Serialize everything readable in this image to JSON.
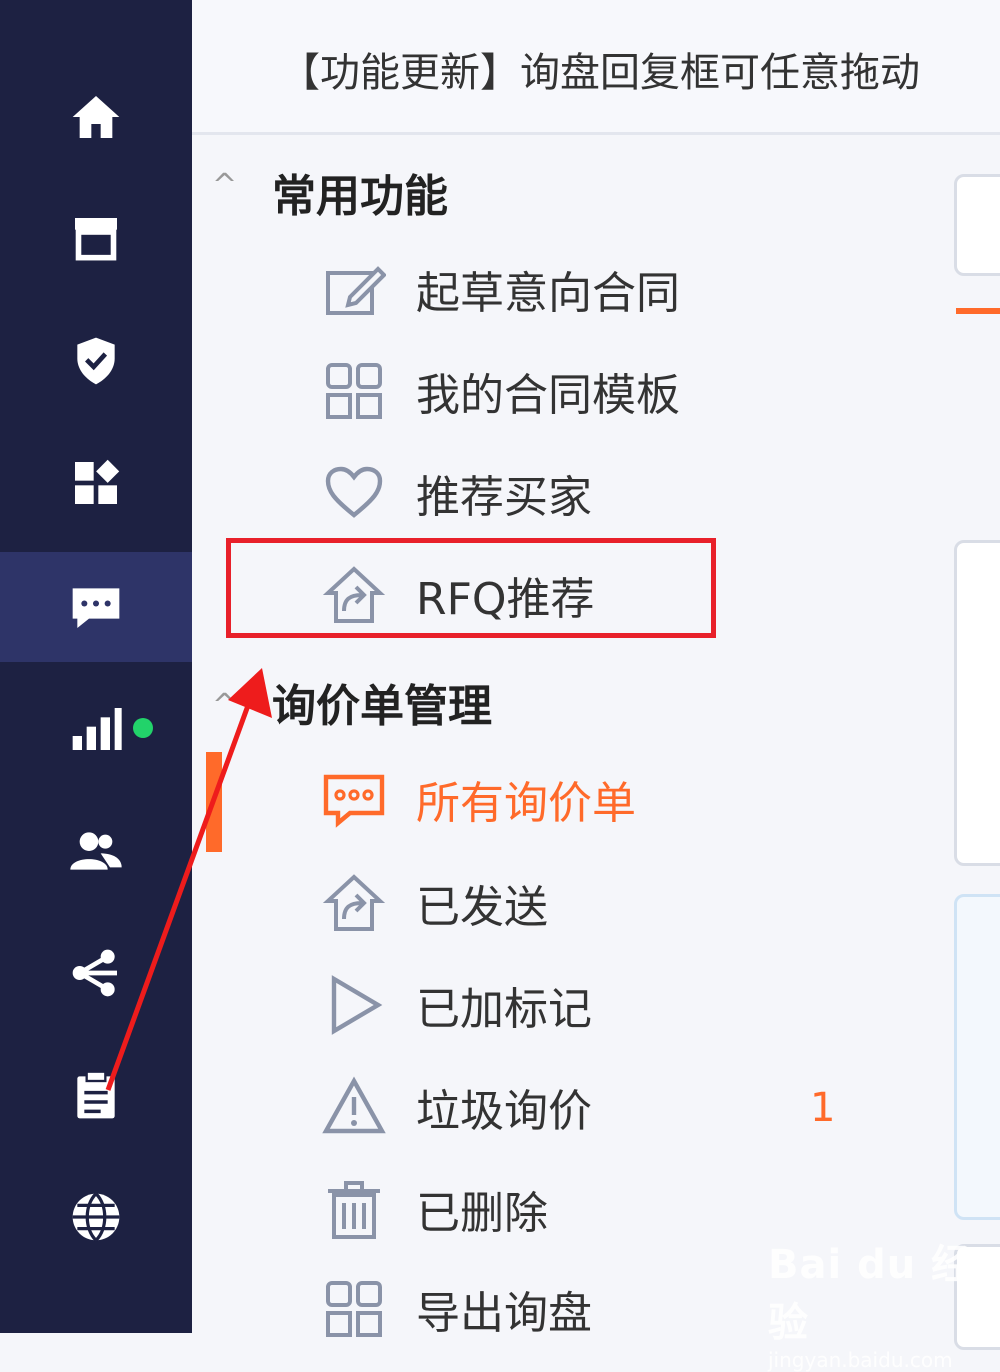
{
  "banner": {
    "text": "【功能更新】询盘回复框可任意拖动"
  },
  "sections": [
    {
      "title": "常用功能",
      "caret": "^"
    },
    {
      "title": "询价单管理",
      "caret": "^"
    }
  ],
  "common_items": [
    {
      "label": "起草意向合同",
      "icon": "edit-icon"
    },
    {
      "label": "我的合同模板",
      "icon": "grid-icon"
    },
    {
      "label": "推荐买家",
      "icon": "heart-icon"
    },
    {
      "label": "RFQ推荐",
      "icon": "house-arrow-icon"
    }
  ],
  "inquiry_items": [
    {
      "label": "所有询价单",
      "icon": "message-icon",
      "active": true
    },
    {
      "label": "已发送",
      "icon": "house-arrow-icon"
    },
    {
      "label": "已加标记",
      "icon": "flag-icon"
    },
    {
      "label": "垃圾询价",
      "icon": "warning-icon",
      "badge": "1"
    },
    {
      "label": "已删除",
      "icon": "trash-icon"
    },
    {
      "label": "导出询盘",
      "icon": "grid-icon"
    }
  ],
  "rail_icons": [
    "home-icon",
    "store-icon",
    "shield-icon",
    "apps-icon",
    "chat-icon",
    "stats-icon",
    "users-icon",
    "network-icon",
    "clipboard-icon",
    "globe-icon"
  ],
  "watermark": {
    "logo": "Bai du 经验",
    "sub": "jingyan.baidu.com"
  },
  "colors": {
    "rail": "#1d2142",
    "rail_active": "#2e3468",
    "accent": "#ff6a2a",
    "highlight": "#e8202a",
    "status_dot": "#22d36a"
  }
}
